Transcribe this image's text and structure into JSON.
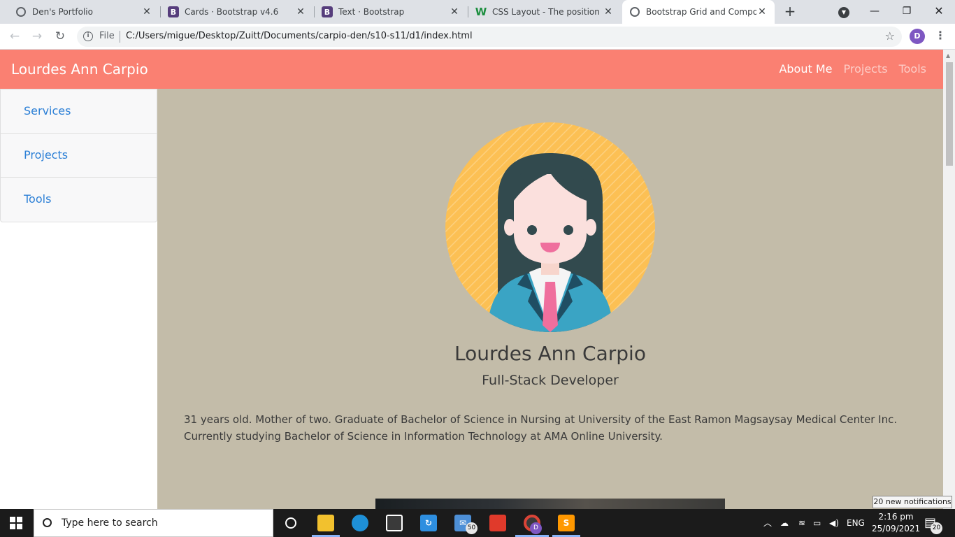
{
  "browser": {
    "tabs": [
      {
        "title": "Den's Portfolio",
        "favicon": "globe-icon",
        "active": false
      },
      {
        "title": "Cards · Bootstrap v4.6",
        "favicon": "bootstrap-icon",
        "active": false
      },
      {
        "title": "Text · Bootstrap",
        "favicon": "bootstrap-icon",
        "active": false
      },
      {
        "title": "CSS Layout - The position Prc",
        "favicon": "w3schools-icon",
        "active": false
      },
      {
        "title": "Bootstrap Grid and Compone",
        "favicon": "globe-icon",
        "active": true
      }
    ],
    "favicon_letters": {
      "bootstrap": "B",
      "w3schools": "W"
    },
    "address": {
      "scheme_label": "File",
      "url": "C:/Users/migue/Desktop/Zuitt/Documents/carpio-den/s10-s11/d1/index.html"
    },
    "profile_initial": "D"
  },
  "page": {
    "navbar": {
      "brand": "Lourdes Ann Carpio",
      "links": [
        {
          "label": "About Me",
          "active": true
        },
        {
          "label": "Projects",
          "active": false
        },
        {
          "label": "Tools",
          "active": false
        }
      ],
      "background": "#fa8072"
    },
    "sidebar": {
      "items": [
        "Services",
        "Projects",
        "Tools"
      ],
      "link_color": "#2b7fd6"
    },
    "profile": {
      "name": "Lourdes Ann Carpio",
      "role": "Full-Stack Developer",
      "bio": "31 years old. Mother of two. Graduate of Bachelor of Science in Nursing at University of the East Ramon Magsaysay Medical Center Inc. Currently studying Bachelor of Science in Information Technology at AMA Online University.",
      "background": "#c3bca9"
    }
  },
  "taskbar": {
    "search_placeholder": "Type here to search",
    "mail_badge": "50",
    "chrome_badge": "D",
    "language": "ENG",
    "time": "2:16 pm",
    "date": "25/09/2021",
    "notification_count": "20",
    "notification_tooltip": "20 new notifications"
  }
}
